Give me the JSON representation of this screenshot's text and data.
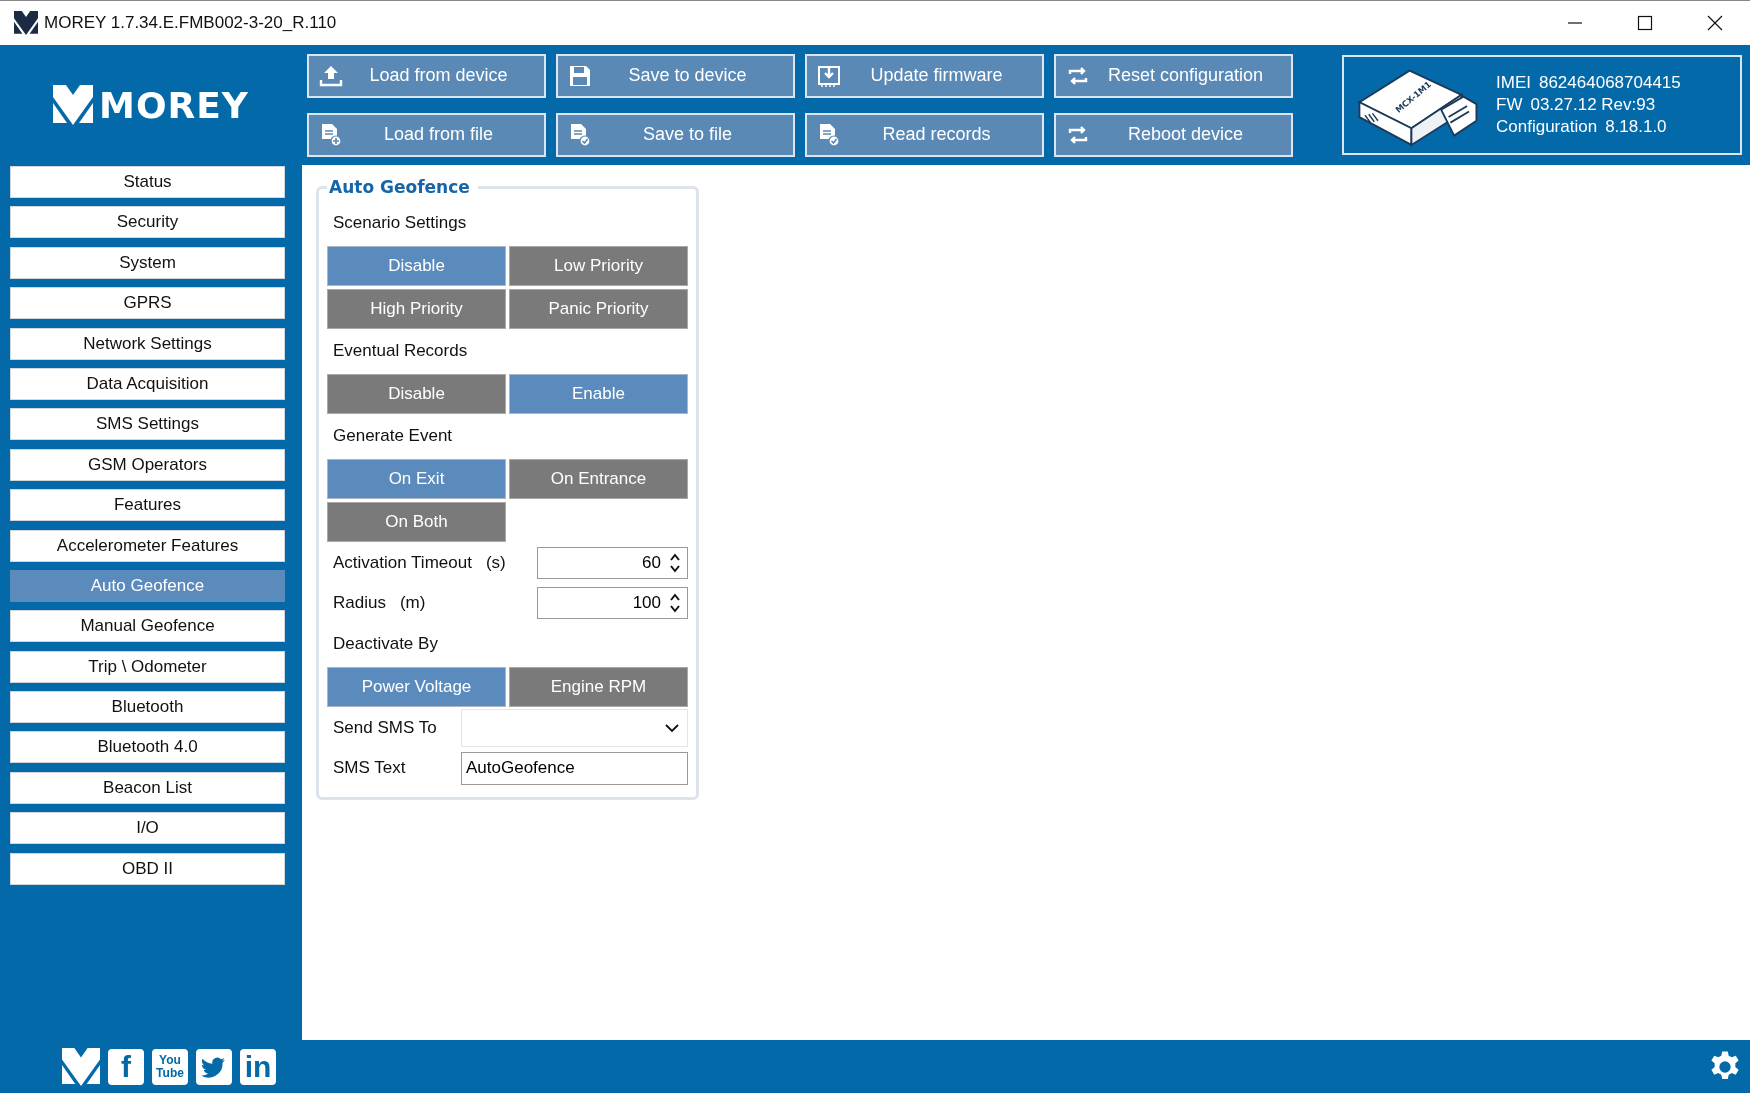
{
  "window": {
    "title": "MOREY 1.7.34.E.FMB002-3-20_R.110"
  },
  "brand": {
    "name": "MOREY"
  },
  "toolbar": [
    {
      "label": "Load from device",
      "kind": "upload"
    },
    {
      "label": "Save to device",
      "kind": "save"
    },
    {
      "label": "Update firmware",
      "kind": "firmware"
    },
    {
      "label": "Reset configuration",
      "kind": "cycle"
    },
    {
      "label": "Load from file",
      "kind": "fileplus"
    },
    {
      "label": "Save to file",
      "kind": "filecheck"
    },
    {
      "label": "Read records",
      "kind": "filecheck"
    },
    {
      "label": "Reboot device",
      "kind": "cycle"
    }
  ],
  "device": {
    "label": "MCX-1M1",
    "lines": [
      {
        "name": "IMEI",
        "value": "862464068704415"
      },
      {
        "name": "FW",
        "value": "03.27.12 Rev:93"
      },
      {
        "name": "Configuration",
        "value": "8.18.1.0"
      }
    ]
  },
  "sidebar": {
    "items": [
      {
        "label": "Status",
        "selected": false
      },
      {
        "label": "Security",
        "selected": false
      },
      {
        "label": "System",
        "selected": false
      },
      {
        "label": "GPRS",
        "selected": false
      },
      {
        "label": "Network Settings",
        "selected": false
      },
      {
        "label": "Data Acquisition",
        "selected": false
      },
      {
        "label": "SMS Settings",
        "selected": false
      },
      {
        "label": "GSM Operators",
        "selected": false
      },
      {
        "label": "Features",
        "selected": false
      },
      {
        "label": "Accelerometer Features",
        "selected": false
      },
      {
        "label": "Auto Geofence",
        "selected": true
      },
      {
        "label": "Manual Geofence",
        "selected": false
      },
      {
        "label": "Trip \\ Odometer",
        "selected": false
      },
      {
        "label": "Bluetooth",
        "selected": false
      },
      {
        "label": "Bluetooth 4.0",
        "selected": false
      },
      {
        "label": "Beacon List",
        "selected": false
      },
      {
        "label": "I/O",
        "selected": false
      },
      {
        "label": "OBD II",
        "selected": false
      }
    ]
  },
  "panel": {
    "title": "Auto Geofence",
    "rows": [
      {
        "kind": "heading",
        "label": "Scenario Settings"
      },
      {
        "kind": "choices",
        "options": [
          {
            "label": "Disable",
            "selected": true
          },
          {
            "label": "Low Priority",
            "selected": false
          },
          {
            "label": "High Priority",
            "selected": false
          },
          {
            "label": "Panic Priority",
            "selected": false
          }
        ]
      },
      {
        "kind": "heading",
        "label": "Eventual Records"
      },
      {
        "kind": "choices",
        "options": [
          {
            "label": "Disable",
            "selected": false
          },
          {
            "label": "Enable",
            "selected": true
          }
        ]
      },
      {
        "kind": "heading",
        "label": "Generate Event"
      },
      {
        "kind": "choices",
        "options": [
          {
            "label": "On Exit",
            "selected": true
          },
          {
            "label": "On Entrance",
            "selected": false
          },
          {
            "label": "On Both",
            "selected": false
          }
        ]
      },
      {
        "kind": "spin",
        "label": "Activation Timeout",
        "unit": "(s)",
        "value": "60"
      },
      {
        "kind": "spin",
        "label": "Radius",
        "unit": "(m)",
        "value": "100"
      },
      {
        "kind": "heading",
        "label": "Deactivate By"
      },
      {
        "kind": "choices",
        "options": [
          {
            "label": "Power Voltage",
            "selected": true
          },
          {
            "label": "Engine RPM",
            "selected": false
          }
        ]
      },
      {
        "kind": "select",
        "label": "Send SMS To"
      },
      {
        "kind": "text",
        "label": "SMS Text",
        "value": "AutoGeofence"
      }
    ]
  },
  "footer": {
    "social": [
      {
        "kind": "brand"
      },
      {
        "kind": "glyph",
        "text": "f"
      },
      {
        "kind": "stacked",
        "lines": [
          "You",
          "Tube"
        ]
      },
      {
        "kind": "bird"
      },
      {
        "kind": "glyph",
        "text": "in"
      }
    ]
  }
}
